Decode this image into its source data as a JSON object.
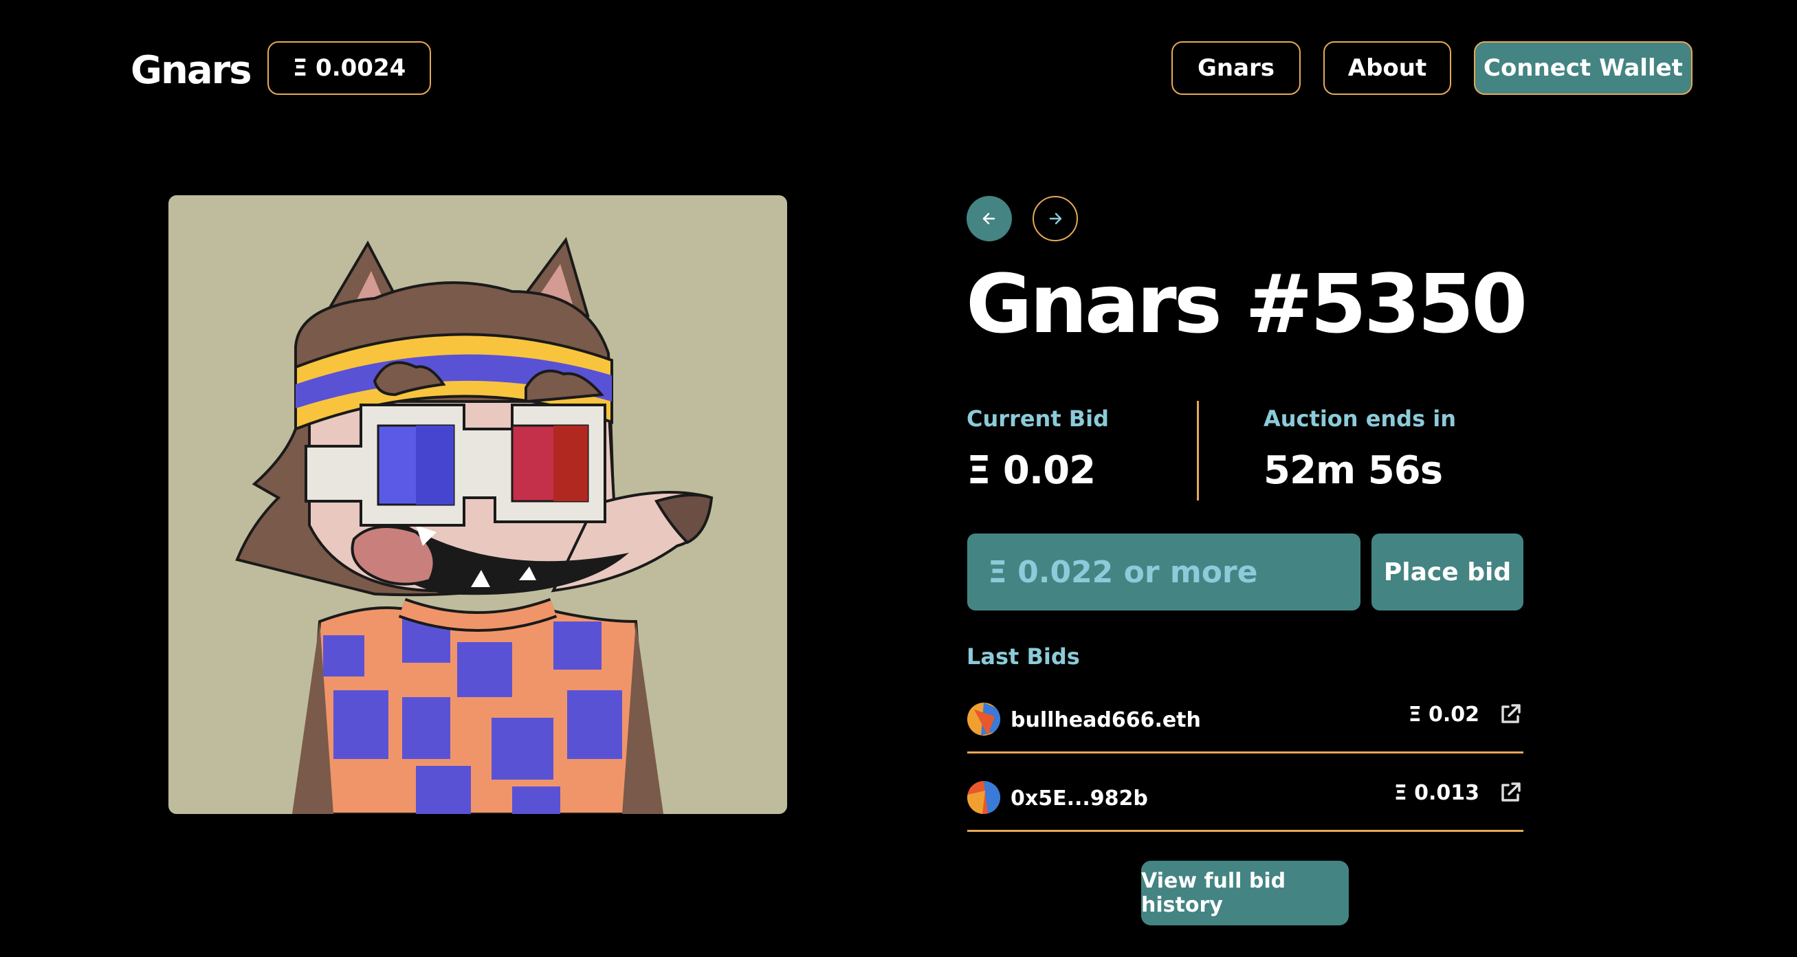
{
  "header": {
    "logo": "Gnars",
    "treasury": "Ξ 0.0024",
    "nav": {
      "gnars": "Gnars",
      "about": "About",
      "connect_wallet": "Connect Wallet"
    }
  },
  "auction": {
    "title": "Gnars #5350",
    "current_bid_label": "Current Bid",
    "current_bid_value": "Ξ 0.02",
    "ends_label": "Auction ends in",
    "ends_value": "52m 56s",
    "bid_placeholder": "Ξ 0.022 or more",
    "place_bid_label": "Place bid"
  },
  "last_bids": {
    "title": "Last Bids",
    "items": [
      {
        "name": "bullhead666.eth",
        "amount": "Ξ 0.02"
      },
      {
        "name": "0x5E...982b",
        "amount": "Ξ 0.013"
      }
    ]
  },
  "history_button": "View full bid history",
  "colors": {
    "background": "#000000",
    "accent_teal": "#448483",
    "border_gold": "#e6a955",
    "label_light_blue": "#8ccbd9",
    "nft_background": "#bebc9c"
  },
  "icons": {
    "prev": "arrow-left-icon",
    "next": "arrow-right-icon",
    "external_link": "external-link-icon"
  }
}
